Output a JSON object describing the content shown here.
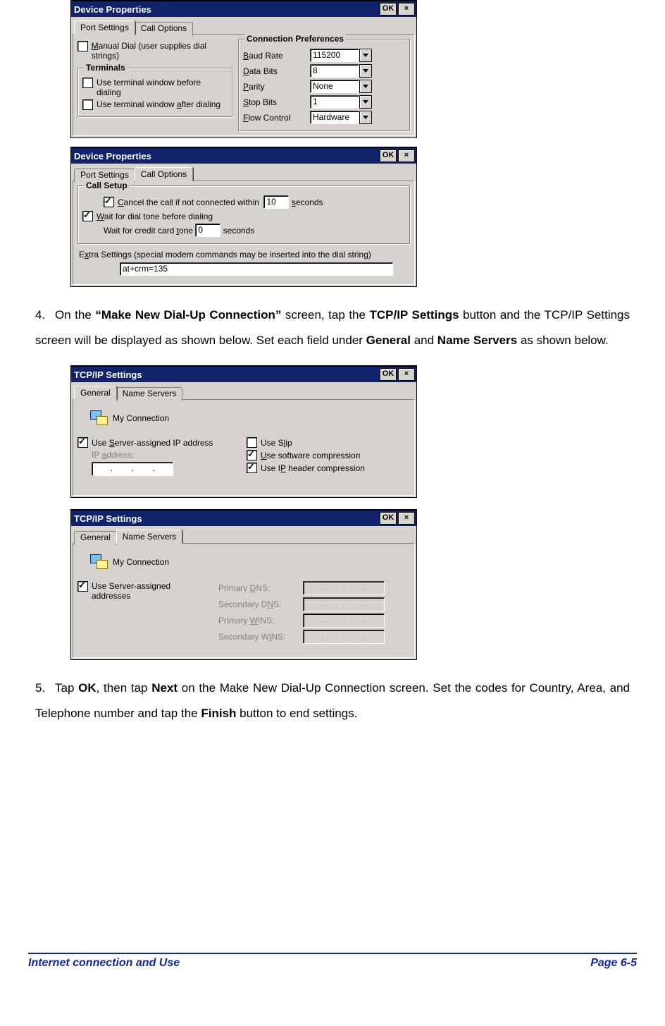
{
  "shot1": {
    "title": "Device Properties",
    "ok": "OK",
    "close": "×",
    "tab1": "Port Settings",
    "tab2": "Call Options",
    "manual_dial_a": "M",
    "manual_dial_b": "anual Dial (user supplies dial strings)",
    "terminals": "Terminals",
    "term_before": "Use terminal window before dialing",
    "term_after_a": "Use terminal window ",
    "term_after_u": "a",
    "term_after_b": "fter dialing",
    "connpref": "Connection Preferences",
    "baud_u": "B",
    "baud": "aud Rate",
    "baud_v": "115200",
    "databits_u": "D",
    "databits": "ata Bits",
    "databits_v": "8",
    "parity_u": "P",
    "parity": "arity",
    "parity_v": "None",
    "stopbits_u": "S",
    "stopbits": "top Bits",
    "stopbits_v": "1",
    "flow_u": "F",
    "flow": "low Control",
    "flow_v": "Hardware"
  },
  "shot2": {
    "title": "Device Properties",
    "ok": "OK",
    "close": "×",
    "tab1": "Port Settings",
    "tab2": "Call Options",
    "callsetup": "Call Setup",
    "cancel_u": "C",
    "cancel_a": "ancel the call if not connected within",
    "cancel_v": "10",
    "cancel_b_u": "s",
    "cancel_b": "econds",
    "wait_u": "W",
    "wait": "ait for dial tone before dialing",
    "credit_a": "Wait for credit card ",
    "credit_u": "t",
    "credit_b": "one",
    "credit_v": "0",
    "seconds": "seconds",
    "extra_a": "E",
    "extra_u": "x",
    "extra_b": "tra Settings (special modem commands may be inserted into the dial string)",
    "extra_v": "at+crm=135"
  },
  "para4": {
    "num": "4.",
    "t1": "On the ",
    "t2": "“Make New Dial-Up Connection”",
    "t3": " screen, tap the ",
    "t4": "TCP/IP Settings",
    "t5": " button and the TCP/IP Settings screen will be displayed as shown below. Set each field under ",
    "t6": "General",
    "t7": " and ",
    "t8": "Name Servers",
    "t9": " as shown below."
  },
  "shot3": {
    "title": "TCP/IP Settings",
    "ok": "OK",
    "close": "×",
    "tab1": "General",
    "tab2": "Name Servers",
    "conn": "My Connection",
    "useip_a": "Use ",
    "useip_u": "S",
    "useip_b": "erver-assigned IP address",
    "ipaddr_a": "IP ",
    "ipaddr_u": "a",
    "ipaddr_b": "ddress:",
    "slip_a": "Use S",
    "slip_u": "l",
    "slip_b": "ip",
    "comp_u": "U",
    "comp": "se software compression",
    "iphdr_a": "Use I",
    "iphdr_u": "P",
    "iphdr_b": " header compression"
  },
  "shot4": {
    "title": "TCP/IP Settings",
    "ok": "OK",
    "close": "×",
    "tab1": "General",
    "tab2": "Name Servers",
    "conn": "My Connection",
    "usesrv": "Use Server-assigned addresses",
    "pdns_a": "Primary ",
    "pdns_u": "D",
    "pdns_b": "NS:",
    "sdns_a": "Secondary D",
    "sdns_u": "N",
    "sdns_b": "S:",
    "pwins_a": "Primary ",
    "pwins_u": "W",
    "pwins_b": "INS:",
    "swins_a": "Secondary W",
    "swins_u": "I",
    "swins_b": "NS:"
  },
  "para5": {
    "num": "5.",
    "t1": "Tap ",
    "t2": "OK",
    "t3": ", then tap ",
    "t4": "Next",
    "t5": " on the Make New Dial-Up Connection screen. Set the codes for Country, Area, and Telephone number and tap the ",
    "t6": "Finish",
    "t7": " button to end settings."
  },
  "footer": {
    "left": "Internet connection and Use",
    "right": "Page 6-5"
  }
}
